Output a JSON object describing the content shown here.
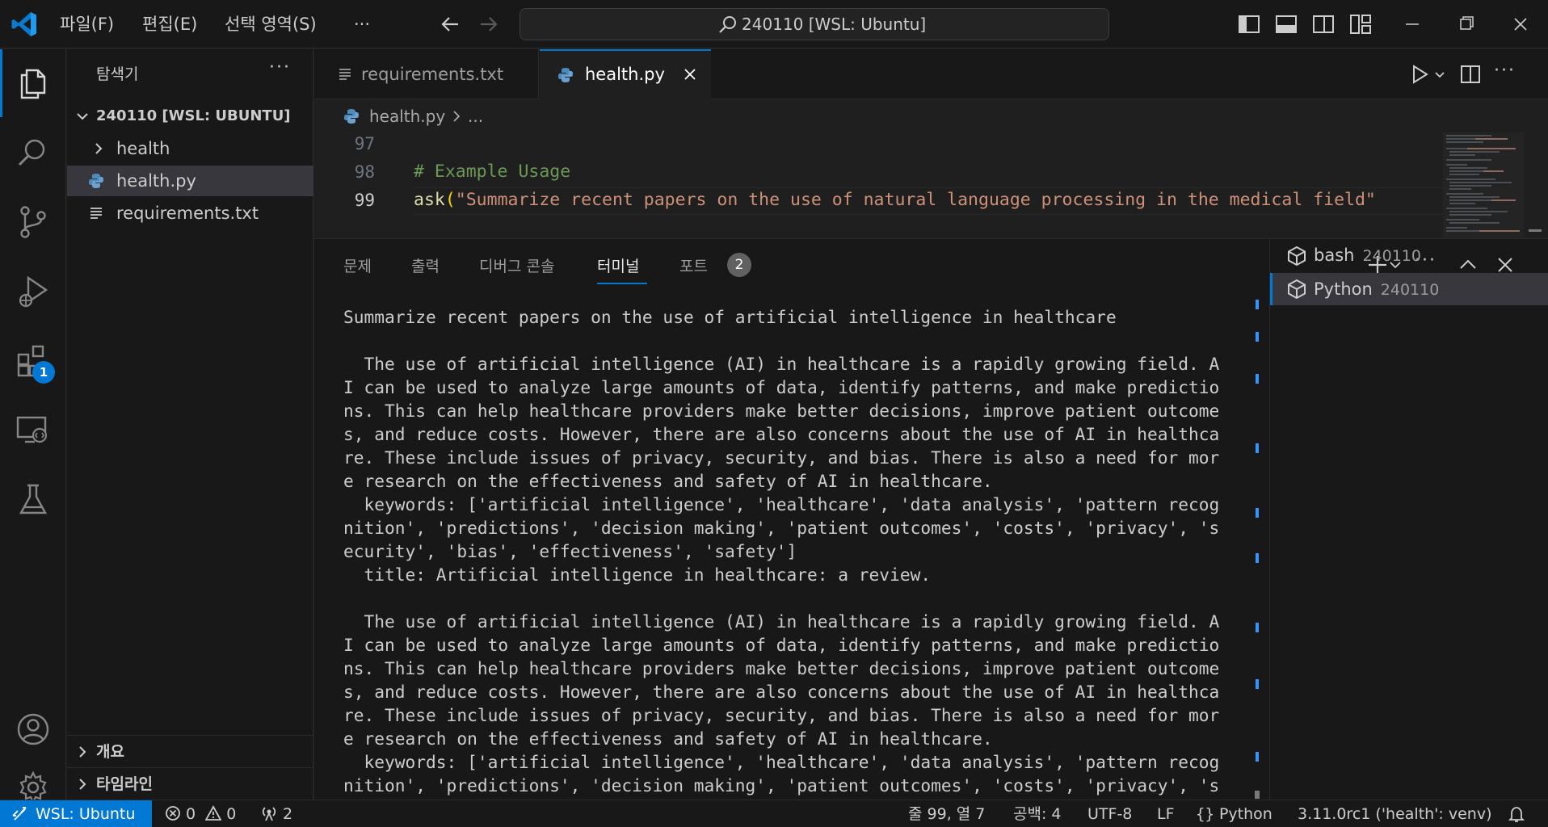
{
  "titlebar": {
    "menu": [
      "파일(F)",
      "편집(E)",
      "선택 영역(S)",
      "···"
    ],
    "search_text": "240110 [WSL: Ubuntu]"
  },
  "activity": {
    "extensions_badge": "1"
  },
  "sidebar": {
    "title": "탐색기",
    "more": "···",
    "workspace": "240110 [WSL: UBUNTU]",
    "items": [
      {
        "label": "health",
        "type": "folder"
      },
      {
        "label": "health.py",
        "type": "python"
      },
      {
        "label": "requirements.txt",
        "type": "text"
      }
    ],
    "sections": [
      "개요",
      "타임라인"
    ]
  },
  "editor": {
    "tabs": [
      {
        "label": "requirements.txt"
      },
      {
        "label": "health.py"
      }
    ],
    "breadcrumb_file": "health.py",
    "breadcrumb_more": "...",
    "lines": [
      {
        "num": "97",
        "text": ""
      },
      {
        "num": "98",
        "text": "# Example Usage"
      },
      {
        "num": "99",
        "fn": "ask",
        "paren": "(",
        "str": "\"Summarize recent papers on the use of natural language processing in the medical field\""
      }
    ]
  },
  "panel": {
    "tabs": [
      "문제",
      "출력",
      "디버그 콘솔",
      "터미널",
      "포트"
    ],
    "ports_badge": "2",
    "terminal_lines": [
      "Summarize recent papers on the use of artificial intelligence in healthcare",
      "",
      "  The use of artificial intelligence (AI) in healthcare is a rapidly growing field. A",
      "I can be used to analyze large amounts of data, identify patterns, and make predictio",
      "ns. This can help healthcare providers make better decisions, improve patient outcome",
      "s, and reduce costs. However, there are also concerns about the use of AI in healthca",
      "re. These include issues of privacy, security, and bias. There is also a need for mor",
      "e research on the effectiveness and safety of AI in healthcare.",
      "  keywords: ['artificial intelligence', 'healthcare', 'data analysis', 'pattern recog",
      "nition', 'predictions', 'decision making', 'patient outcomes', 'costs', 'privacy', 's",
      "ecurity', 'bias', 'effectiveness', 'safety']",
      "  title: Artificial intelligence in healthcare: a review.",
      "",
      "  The use of artificial intelligence (AI) in healthcare is a rapidly growing field. A",
      "I can be used to analyze large amounts of data, identify patterns, and make predictio",
      "ns. This can help healthcare providers make better decisions, improve patient outcome",
      "s, and reduce costs. However, there are also concerns about the use of AI in healthca",
      "re. These include issues of privacy, security, and bias. There is also a need for mor",
      "e research on the effectiveness and safety of AI in healthcare.",
      "  keywords: ['artificial intelligence', 'healthcare', 'data analysis', 'pattern recog",
      "nition', 'predictions', 'decision making', 'patient outcomes', 'costs', 'privacy', 's"
    ],
    "sessions": [
      {
        "name": "bash",
        "sub": "240110"
      },
      {
        "name": "Python",
        "sub": "240110"
      }
    ]
  },
  "statusbar": {
    "remote": "WSL: Ubuntu",
    "errors": "0",
    "warnings": "0",
    "ports": "2",
    "position": "줄 99, 열 7",
    "spaces": "공백: 4",
    "encoding": "UTF-8",
    "eol": "LF",
    "language": "Python",
    "interpreter": "3.11.0rc1 ('health': venv)"
  },
  "colors": {
    "accent": "#0078d4",
    "comment": "#6a9955",
    "string": "#ce9178",
    "function": "#dcdcaa"
  }
}
